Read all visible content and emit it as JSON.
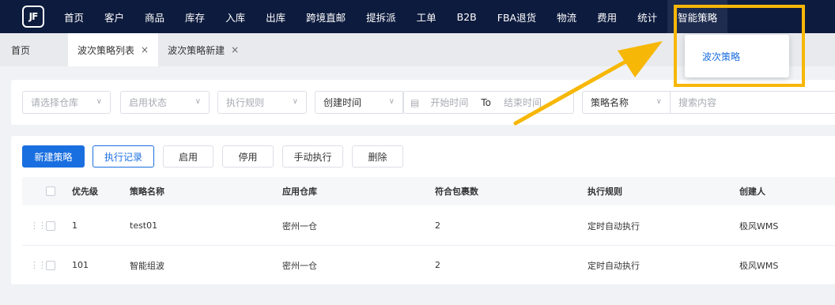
{
  "logo": {
    "text": "JF"
  },
  "nav": {
    "items": [
      "首页",
      "客户",
      "商品",
      "库存",
      "入库",
      "出库",
      "跨境直邮",
      "提拆派",
      "工单",
      "B2B",
      "FBA退货",
      "物流",
      "费用",
      "统计",
      "智能策略"
    ],
    "active_index": 14,
    "dropdown_item": "波次策略"
  },
  "tabs": {
    "home": "首页",
    "list": "波次策略列表",
    "create": "波次策略新建",
    "close_glyph": "×"
  },
  "filters": {
    "warehouse_placeholder": "请选择仓库",
    "status_placeholder": "启用状态",
    "rule_placeholder": "执行规则",
    "time_type": "创建时间",
    "start_placeholder": "开始时间",
    "to_label": "To",
    "end_placeholder": "结束时间",
    "search_field": "策略名称",
    "search_placeholder": "搜索内容"
  },
  "toolbar": {
    "new": "新建策略",
    "records": "执行记录",
    "enable": "启用",
    "disable": "停用",
    "manual": "手动执行",
    "delete": "删除"
  },
  "table": {
    "headers": [
      "优先级",
      "策略名称",
      "应用仓库",
      "符合包裹数",
      "执行规则",
      "创建人"
    ],
    "rows": [
      [
        "1",
        "test01",
        "密州一仓",
        "2",
        "定时自动执行",
        "极风WMS"
      ],
      [
        "101",
        "智能组波",
        "密州一仓",
        "2",
        "定时自动执行",
        "极风WMS"
      ]
    ]
  },
  "colors": {
    "nav_bg": "#0d1b3e",
    "primary": "#1a6fe0",
    "highlight": "#f7b707"
  }
}
